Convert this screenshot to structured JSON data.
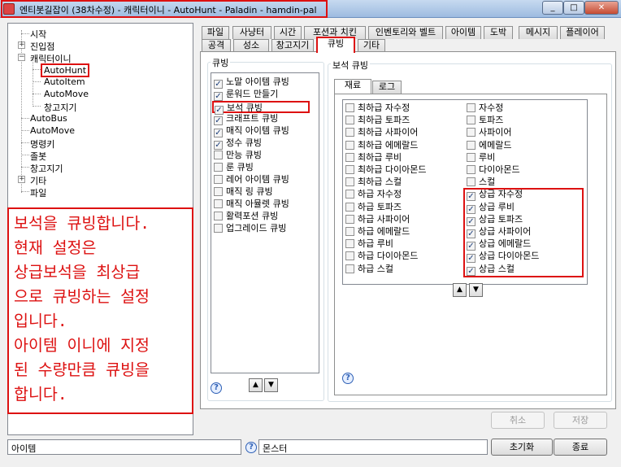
{
  "window": {
    "title": "엔티봇길잡이 (38차수정) - 캐릭터이니 - AutoHunt - Paladin - hamdin-pal",
    "minimize": "_",
    "maximize": "□",
    "close": "✕"
  },
  "tree": {
    "items": [
      "시작",
      "진입점",
      "캐릭터이니",
      "AutoHunt",
      "AutoItem",
      "AutoMove",
      "창고지기",
      "AutoBus",
      "AutoMove",
      "명령키",
      "졸봇",
      "창고지기",
      "기타",
      "파일"
    ],
    "expander_plus": "+",
    "expander_minus": "−"
  },
  "note": {
    "lines": [
      "보석을 큐빙합니다.",
      "현재 설정은",
      "상급보석을 최상급",
      "으로 큐빙하는 설정",
      "입니다.",
      "아이템 이니에 지정",
      "된 수량만큼 큐빙을",
      "합니다."
    ]
  },
  "tabs": {
    "row1": [
      "파일",
      "사냥터",
      "시간",
      "포션과 치킨",
      "인벤토리와 벨트",
      "아이템",
      "도박",
      "메시지",
      "플레이어"
    ],
    "row2": [
      "공격",
      "성소",
      "창고지기",
      "큐빙",
      "기타"
    ],
    "active": "큐빙"
  },
  "cubing": {
    "group_label": "큐빙",
    "items": [
      {
        "label": "노말 아이템 큐빙",
        "checked": true
      },
      {
        "label": "룬워드 만들기",
        "checked": true
      },
      {
        "label": "보석 큐빙",
        "checked": true
      },
      {
        "label": "크래프트 큐빙",
        "checked": true
      },
      {
        "label": "매직 아이템 큐빙",
        "checked": true
      },
      {
        "label": "정수 큐빙",
        "checked": true
      },
      {
        "label": "만능 큐빙",
        "checked": false
      },
      {
        "label": "룬 큐빙",
        "checked": false
      },
      {
        "label": "레어 아이템 큐빙",
        "checked": false
      },
      {
        "label": "매직 링 큐빙",
        "checked": false
      },
      {
        "label": "매직 아뮬렛 큐빙",
        "checked": false
      },
      {
        "label": "활력포션 큐빙",
        "checked": false
      },
      {
        "label": "업그레이드 큐빙",
        "checked": false
      }
    ],
    "help": "?",
    "up": "▲",
    "down": "▼"
  },
  "gem": {
    "group_label": "보석 큐빙",
    "subtabs": [
      "재료",
      "로그"
    ],
    "col1": [
      {
        "label": "최하급 자수정",
        "checked": false
      },
      {
        "label": "최하급 토파즈",
        "checked": false
      },
      {
        "label": "최하급 사파이어",
        "checked": false
      },
      {
        "label": "최하급 에메랄드",
        "checked": false
      },
      {
        "label": "최하급 루비",
        "checked": false
      },
      {
        "label": "최하급 다이아몬드",
        "checked": false
      },
      {
        "label": "최하급 스컬",
        "checked": false
      },
      {
        "label": "하급 자수정",
        "checked": false
      },
      {
        "label": "하급 토파즈",
        "checked": false
      },
      {
        "label": "하급 사파이어",
        "checked": false
      },
      {
        "label": "하급 에메랄드",
        "checked": false
      },
      {
        "label": "하급 루비",
        "checked": false
      },
      {
        "label": "하급 다이아몬드",
        "checked": false
      },
      {
        "label": "하급 스컬",
        "checked": false
      }
    ],
    "col2": [
      {
        "label": "자수정",
        "checked": false
      },
      {
        "label": "토파즈",
        "checked": false
      },
      {
        "label": "사파이어",
        "checked": false
      },
      {
        "label": "에메랄드",
        "checked": false
      },
      {
        "label": "루비",
        "checked": false
      },
      {
        "label": "다이아몬드",
        "checked": false
      },
      {
        "label": "스컬",
        "checked": false
      },
      {
        "label": "상급 자수정",
        "checked": true
      },
      {
        "label": "상급 루비",
        "checked": true
      },
      {
        "label": "상급 토파즈",
        "checked": true
      },
      {
        "label": "상급 사파이어",
        "checked": true
      },
      {
        "label": "상급 에메랄드",
        "checked": true
      },
      {
        "label": "상급 다이아몬드",
        "checked": true
      },
      {
        "label": "상급 스컬",
        "checked": true
      }
    ],
    "help": "?",
    "up": "▲",
    "down": "▼"
  },
  "buttons": {
    "cancel": "취소",
    "save": "저장",
    "reset": "초기화",
    "exit": "종료"
  },
  "status": {
    "item": "아이템",
    "help": "?",
    "monster": "몬스터"
  },
  "colors": {
    "highlight": "#dd1111",
    "check": "#1c3e7a"
  }
}
